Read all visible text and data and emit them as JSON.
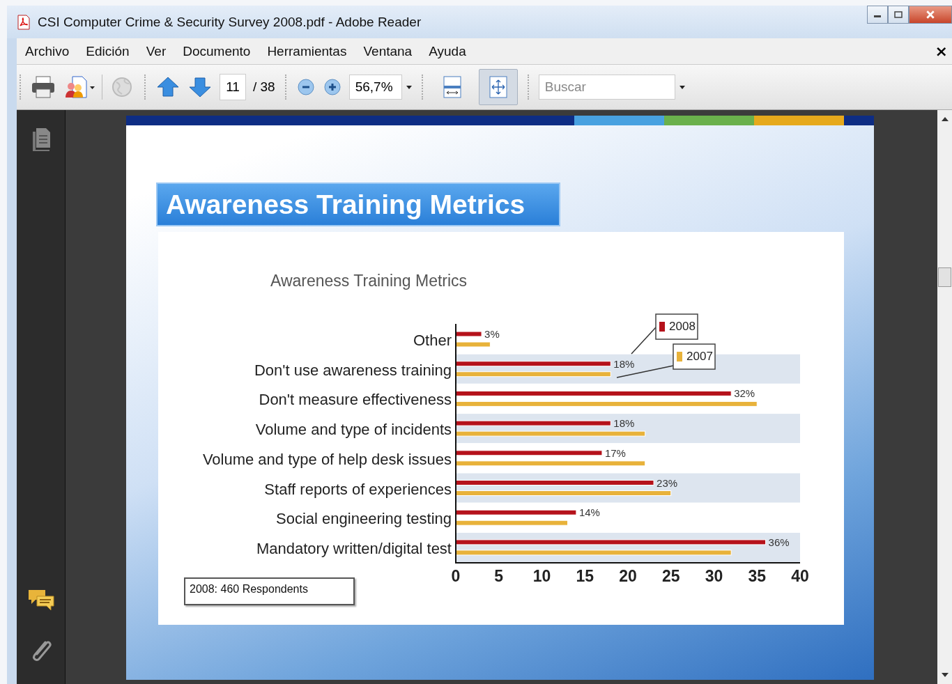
{
  "window": {
    "title": "CSI Computer Crime & Security Survey 2008.pdf - Adobe Reader"
  },
  "menu": {
    "items": [
      "Archivo",
      "Edición",
      "Ver",
      "Documento",
      "Herramientas",
      "Ventana",
      "Ayuda"
    ],
    "close": "×"
  },
  "toolbar": {
    "page": "11",
    "page_total": "/ 38",
    "zoom": "56,7%",
    "search": {
      "placeholder": "Buscar"
    },
    "view_buttons": [
      {
        "kind": "fit-width",
        "selected": false
      },
      {
        "kind": "fit-page",
        "selected": true
      }
    ]
  },
  "slide": {
    "title": "Awareness Training Metrics",
    "note": "2008: 460 Respondents",
    "chart_data": {
      "type": "bar",
      "orientation": "horizontal",
      "title": "Awareness Training Metrics",
      "categories": [
        "Other",
        "Don't use awareness training",
        "Don't measure effectiveness",
        "Volume and type of incidents",
        "Volume and type of help desk issues",
        "Staff reports of experiences",
        "Social engineering testing",
        "Mandatory written/digital test"
      ],
      "series": [
        {
          "name": "2008",
          "color": "#b5121b",
          "values": [
            3,
            18,
            32,
            18,
            17,
            23,
            14,
            36
          ]
        },
        {
          "name": "2007",
          "color": "#e8b23a",
          "values": [
            4,
            18,
            35,
            22,
            22,
            25,
            13,
            32
          ]
        }
      ],
      "legend": "upper right",
      "xlim": [
        0,
        40
      ],
      "xticks": [
        0,
        5,
        10,
        15,
        20,
        25,
        30,
        35,
        40
      ],
      "value_labels": [
        "3%",
        "18%",
        "32%",
        "18%",
        "17%",
        "23%",
        "14%",
        "36%"
      ]
    }
  }
}
